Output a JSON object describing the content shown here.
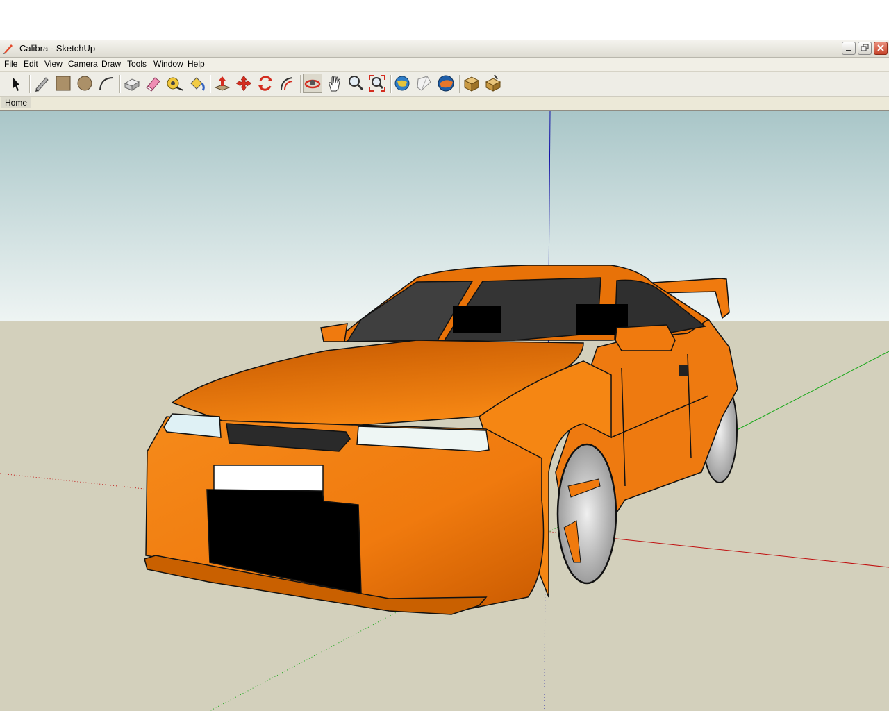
{
  "window": {
    "title": "Calibra - SketchUp",
    "active_tab": "Home"
  },
  "menu": [
    "File",
    "Edit",
    "View",
    "Camera",
    "Draw",
    "Tools",
    "Window",
    "Help"
  ],
  "toolbar": [
    "select-tool",
    "pencil-tool",
    "rectangle-tool",
    "circle-tool",
    "arc-tool",
    "make-component-tool",
    "eraser-tool",
    "tape-measure-tool",
    "paint-bucket-tool",
    "push-pull-tool",
    "move-tool",
    "rotate-tool",
    "offset-tool",
    "orbit-tool",
    "pan-tool",
    "zoom-tool",
    "zoom-extents-tool",
    "get-models-tool",
    "share-model-tool",
    "google-earth-tool",
    "components-tool",
    "styles-tool"
  ],
  "colors": {
    "sky_top": "#a9c6c8",
    "sky_bottom": "#edf3f2",
    "ground": "#d3d0bc",
    "car_body": "#f07a0e",
    "car_dark": "#b84f00",
    "glass": "#3f3f3f",
    "axis_blue": "#1212a6",
    "axis_red": "#c01010",
    "axis_green": "#18a818"
  }
}
